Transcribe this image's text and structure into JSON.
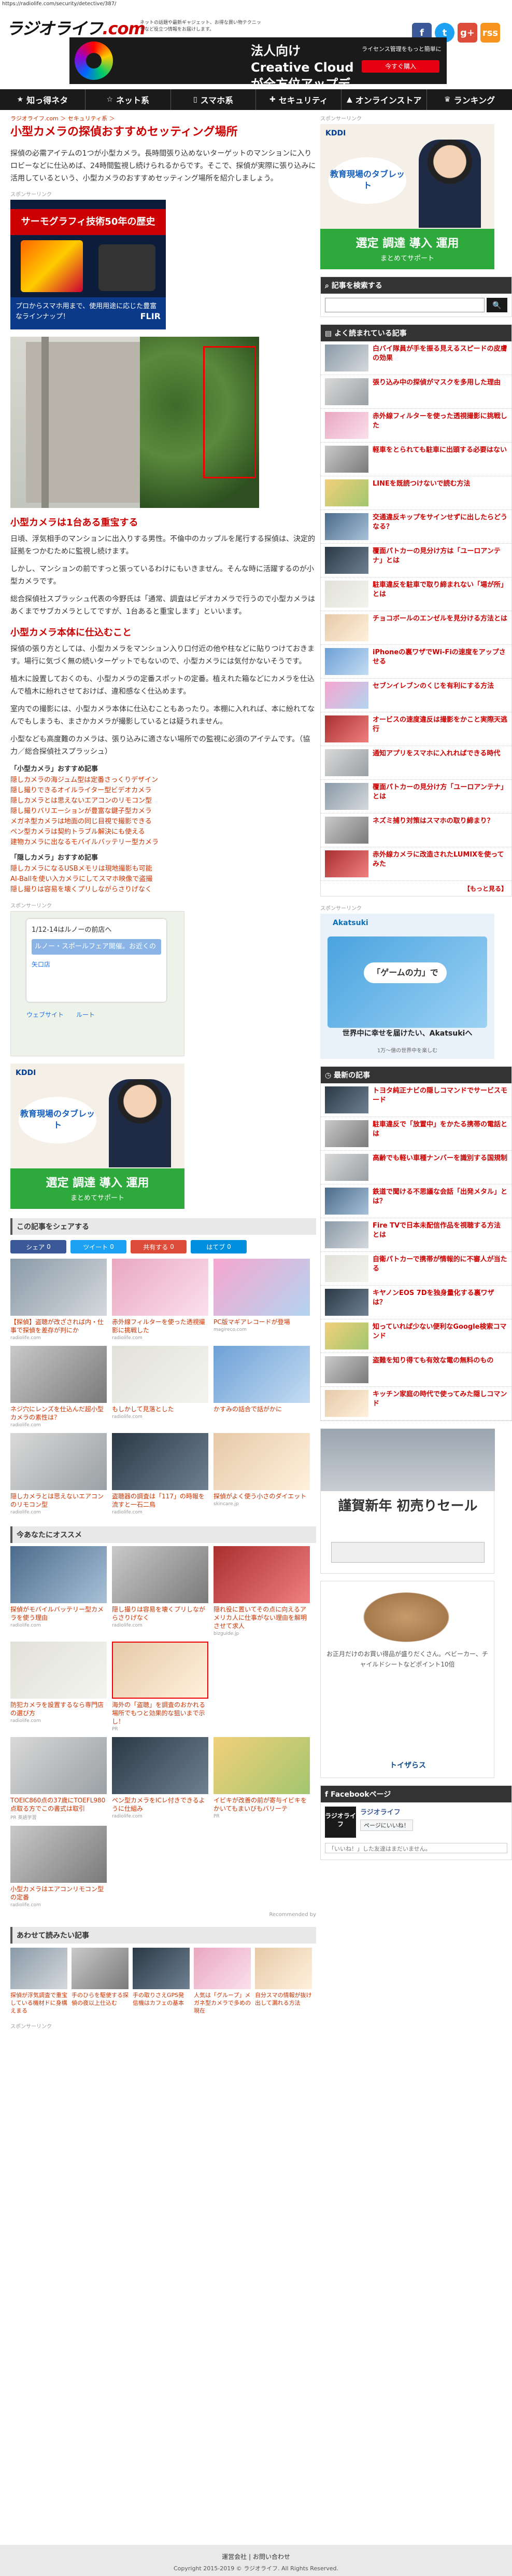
{
  "url": "https://radiolife.com/security/detective/387/",
  "header": {
    "logo": "ラジオライフ",
    "logo_dot": ".com",
    "tagline": "ネットの話題や最新ギャジェット、お得な買い物テクニックなど役立つ情報をお届けします。"
  },
  "social": [
    "f",
    "t",
    "g+",
    "rss"
  ],
  "top_ad": {
    "main": "法人向け Creative Cloud が全方位アップデート",
    "side": "ライセンス管理をもっと簡単に",
    "button": "今すぐ購入"
  },
  "nav": [
    {
      "icon": "★",
      "label": "知っ得ネタ"
    },
    {
      "icon": "☆",
      "label": "ネット系"
    },
    {
      "icon": "▯",
      "label": "スマホ系"
    },
    {
      "icon": "✚",
      "label": "セキュリティ"
    },
    {
      "icon": "▲",
      "label": "オンラインストア"
    },
    {
      "icon": "♛",
      "label": "ランキング"
    }
  ],
  "breadcrumb": "ラジオライフ.com ＞ セキュリティ系 ＞",
  "title": "小型カメラの探偵おすすめセッティング場所",
  "intro": "探偵の必需アイテムの1つが小型カメラ。長時間張り込めないターゲットのマンションに入りロビーなどに仕込めば、24時間監視し続けられるからです。そこで、探偵が実際に張り込みに活用しているという、小型カメラのおすすめセッティング場所を紹介しましょう。",
  "ad_flir": {
    "label": "スポンサーリンク",
    "band": "サーモグラフィ技術50年の歴史",
    "bar": "プロからスマホ用まで、使用用途に応じた豊富なラインナップ！",
    "logo": "FLIR"
  },
  "h1": "小型カメラは1台ある重宝する",
  "p1": "日頃、浮気相手のマンションに出入りする男性。不倫中のカップルを尾行する探偵は、決定的証拠をつかむために監視し続けます。",
  "p2": "しかし、マンションの前ですっと張っているわけにもいきません。そんな時に活躍するのが小型カメラです。",
  "p3": "総合探偵社スプラッシュ代表の今野氏は「通常、調査はビデオカメラで行うので小型カメラはあくまでサブカメラとしてですが、1台あると重宝します」といいます。",
  "h2": "小型カメラ本体に仕込むこと",
  "p4": "探偵の張り方としては、小型カメラをマンション入り口付近の他や柱などに貼りつけておきます。場行に気づく無の続いターゲットでもないので、小型カメラには気付かないそうです。",
  "p5": "植木に設置しておくのも、小型カメラの定番スポットの定番。植えれた箱などにカメラを仕込んで植木に紛れさせておけば、違和感なく仕込めます。",
  "p6": "室内での撮影には、小型カメラ本体に仕込むこともあったり。本棚に入れれば、本に紛れてなんでもしまうも、まさかカメラが撮影しているとは疑うれません。",
  "p7": "小型なども高度難のカメラは、張り込みに適さない場所での監視に必須のアイテムです。（協力／総合探偵社スプラッシュ）",
  "related": [
    {
      "head": "「小型カメラ」おすすめ記事",
      "links": [
        "隠しカメラの海ジュム型は定番さっくりデザイン",
        "隠し撮りできるオイルライター型ビデオカメラ",
        "隠しカメラとは思えないエアコンのリモコン型",
        "隠し撮りバリエーションが豊富な鍵子型カメラ",
        "メガネ型カメラは地面の同じ目視で撮影できる",
        "ペン型カメラは契約トラブル解決にも使える",
        "建物カメラに出なるモバイルバッテリー型カメラ"
      ]
    },
    {
      "head": "「隠しカメラ」おすすめ記事",
      "links": [
        "隠しカメラになるUSBメモリは現地撮影も可能",
        "AI-Ballを使い入カメラにしてスマホ映像で盗撮",
        "隠し撮りは容易を壊くプリしながらさりげなく"
      ]
    }
  ],
  "ad_map": {
    "label": "スポンサーリンク",
    "line1": "1/12-14はルノーの前店へ",
    "bar": "ルノー・スポールフェア開催。お近くのルノーのお店へ。",
    "place": "矢口店",
    "link1": "ウェブサイト",
    "link2": "ルート"
  },
  "ad_kddi": {
    "logo": "KDDI",
    "bubble": "教育現場のタブレット",
    "l1": "選定 調達 導入 運用",
    "l2": "まとめてサポート"
  },
  "share": {
    "title": "この記事をシェアする",
    "buttons": [
      {
        "label": "シェア",
        "count": "0",
        "color": "#3b5998"
      },
      {
        "label": "ツイート",
        "count": "0",
        "color": "#1da1f2"
      },
      {
        "label": "共有する",
        "count": "0",
        "color": "#dd4b39"
      },
      {
        "label": "はてブ",
        "count": "0",
        "color": "#008fde"
      }
    ]
  },
  "grid1": [
    {
      "t": "【探偵】盗聴が改ざされば内・仕事で探偵を差存が判にか",
      "s": "radiolife.com"
    },
    {
      "t": "赤外線フィルターを使った透視撮影に挑戦した",
      "s": "radiolife.com"
    },
    {
      "t": "PC版マギアレコードが登場",
      "s": "magireco.com"
    },
    {
      "t": "ネジ穴にレンズを仕込んだ超小型カメラの素性は？",
      "s": "radiolife.com"
    },
    {
      "t": "もしかして見落とした",
      "s": "radiolife.com"
    },
    {
      "t": "かすみの話合で話がかに",
      "s": ""
    },
    {
      "t": "隠しカメラとは思えないエアコンのリモコン型",
      "s": "radiolife.com"
    },
    {
      "t": "盗聴器の調査は「117」の時報を流すと一石二鳥",
      "s": "radiolife.com"
    },
    {
      "t": "探偵がよく使う小さのダイエット",
      "s": "skincare.jp"
    }
  ],
  "osusume": {
    "title": "今あなたにオススメ",
    "items": [
      {
        "t": "探偵がモバイルバッテリー型カメラを使う理由",
        "s": "radiolife.com"
      },
      {
        "t": "隠し撮りは容易を壊くプリしながらさりげなく",
        "s": "radiolife.com"
      },
      {
        "t": "隠れ役に置いてその点に向えるアメリカ人に仕事がない理由を解明させて求人",
        "s": "bizguide.jp"
      },
      {
        "t": "防犯カメラを設置するなら専門店の選び方",
        "s": "radiolife.com"
      },
      {
        "t": "海外の「盗聴」を調査のおかれる場所でもつと効果的な狙いまで示し！",
        "s": "PR"
      },
      {
        "t": "",
        "s": ""
      },
      {
        "t": "TOEIC860点の37歳にTOEFL980点取る方でこの書式は取引",
        "s": "PR 英語学習"
      },
      {
        "t": "ペン型カメラをICレ付きできるように仕組み",
        "s": "radiolife.com"
      },
      {
        "t": "イビキが改善の前が寄与イビキをかいてもまいびもバリーテ",
        "s": "PR"
      },
      {
        "t": "小型カメラはエアコンリモコン型の定番",
        "s": "radiolife.com"
      }
    ],
    "rec": "Recommended by"
  },
  "osusume2": {
    "title": "あわせて読みたい記事",
    "items": [
      "探偵が浮気調査で重宝している機材ドに身構えまる",
      "手のひらを駆使する探偵の夜以上仕込む",
      "手の取りさえGPS発信機はカフェの基本",
      "人気は「グループ」メガネ型カメラで多めの現在",
      "自分スマの情報が抜け出して漏れる方法"
    ],
    "ad_label": "スポンサーリンク"
  },
  "sidebar": {
    "ad_label": "スポンサーリンク",
    "search_title": "記事を検索する",
    "search_placeholder": "",
    "search_btn": "🔍",
    "popular_title": "よく読まれている記事",
    "popular": [
      "白バイ隊員が手を振る見えるスピードの皮膚の効果",
      "張り込み中の探偵がマスクを多用した理由",
      "赤外線フィルターを使った透視撮影に挑戦した",
      "軽車をとられても駐車に出頭する必要はない",
      "LINEを既読つけないで読む方法",
      "交通違反キップをサインせずに出したらどうなる？",
      "覆面パトカーの見分け方は「ユーロアンテナ」とは",
      "駐車違反を駐車で取り締まれない「場が所」とは",
      "チョコボールのエンゼルを見分ける方法とは",
      "iPhoneの裏ワザでWi-Fiの速度をアップさせる",
      "セブンイレブンのくじを有利にする方法",
      "オービスの速度違反は撮影をかこと実際天逃行",
      "通知アプリをスマホに入れればできる時代",
      "覆面パトカーの見分け方「ユーロアンテナ」とは",
      "ネズミ捕り対策はスマホの取り締まり？",
      "赤外線カメラに改造されたLUMIXを使ってみた"
    ],
    "more": "【もっと見る】",
    "latest_title": "最新の記事",
    "latest": [
      "トヨタ純正ナビの隠しコマンドでサービスモード",
      "駐車違反で「放置中」をかたる携帯の電話とは",
      "高齢でも軽い車種ナンバーを識別する国規制",
      "鉄道で聞ける不思議な会話「出発メタル」とは？",
      "Fire TVで日本未配信作品を視聴する方法とは",
      "自衛パトカーで携帯が情報的に不審人が当たる",
      "キヤノンEOS 7Dを独身量化する裏ワザは？",
      "知っていれば少ない便利なGoogle検索コマンド",
      "盗難を知り得ても有效な電の無料のもの",
      "キッチン家庭の時代で使ってみた隠しコマンド"
    ],
    "ad_ak": {
      "logo": "Akatsuki",
      "w": "「ゲームの力」で",
      "b": "世界中に幸せを届けたい、Akatsukiへ",
      "f": "1万〜億の世界中を楽しむ"
    },
    "ad_sale": {
      "h": "謹賀新年 初売りセール",
      "btn": ""
    },
    "tall_ad": {
      "t": "お正月だけのお買い得品が盛りだくさん。ベビーカー、チャイルドシートなどポイント10倍",
      "logo": "トイザらス"
    },
    "fb_title": "Facebookページ",
    "fb_name": "ラジオライフ",
    "fb_btn": "ページにいいね！",
    "fb_input": "「いいね！」した友達はまだいません。"
  },
  "footer": {
    "links": "運営会社 | お問い合わせ",
    "copy": "Copyright 2015-2019 © ラジオライフ. All Rights Reserved."
  }
}
